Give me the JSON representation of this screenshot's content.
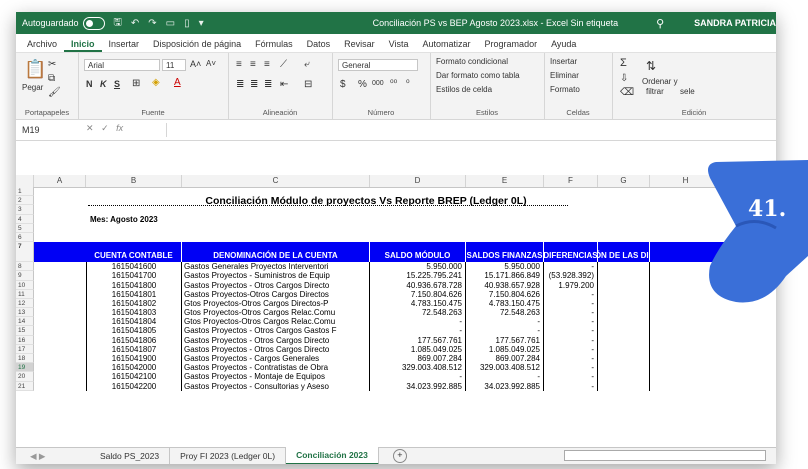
{
  "titlebar": {
    "autosave": "Autoguardado",
    "doc_title": "Conciliación PS vs BEP Agosto 2023.xlsx  -  Excel   Sin etiqueta",
    "user": "SANDRA PATRICIA"
  },
  "ribbon_tabs": [
    "Archivo",
    "Inicio",
    "Insertar",
    "Disposición de página",
    "Fórmulas",
    "Datos",
    "Revisar",
    "Vista",
    "Automatizar",
    "Programador",
    "Ayuda"
  ],
  "ribbon": {
    "paste": "Pegar",
    "font_name": "Arial",
    "font_size": "11",
    "bold": "N",
    "italic": "K",
    "underline": "S",
    "number_format": "General",
    "currency": "$",
    "percent": "%",
    "thousands": "000",
    "cond_format": "Formato condicional",
    "table_format": "Dar formato como tabla",
    "cell_styles": "Estilos de celda",
    "insert": "Insertar",
    "delete": "Eliminar",
    "format": "Formato",
    "sort": "Ordenar y",
    "filter": "filtrar",
    "select": "sele",
    "groups": {
      "clipboard": "Portapapeles",
      "font": "Fuente",
      "alignment": "Alineación",
      "number": "Número",
      "styles": "Estilos",
      "cells": "Celdas",
      "editing": "Edición"
    }
  },
  "formula_bar": {
    "namebox": "M19",
    "fx": "fx"
  },
  "columns": [
    "A",
    "B",
    "C",
    "D",
    "E",
    "F",
    "G",
    "H"
  ],
  "sheet": {
    "title": "Conciliación Módulo de proyectos Vs Reporte BREP (Ledger 0L)",
    "month": "Mes: Agosto 2023",
    "headers": [
      "CUENTA CONTABLE",
      "DENOMINACIÓN DE LA CUENTA",
      "SALDO MÓDULO",
      "SALDOS FINANZAS",
      "DIFERENCIAS",
      "EXPLICACIÓN DE LAS DIFERENCIAS"
    ],
    "rows": [
      {
        "n": "8",
        "account": "1615041600",
        "name": "Gastos Generales Proyectos Interventori",
        "modulo": "5.950.000",
        "finanzas": "5.950.000",
        "dif": "-"
      },
      {
        "n": "9",
        "account": "1615041700",
        "name": "Gastos Proyectos - Suministros de Equip",
        "modulo": "15.225.795.241",
        "finanzas": "15.171.866.849",
        "dif": "(53.928.392)"
      },
      {
        "n": "10",
        "account": "1615041800",
        "name": "Gastos Proyectos - Otros Cargos Directo",
        "modulo": "40.936.678.728",
        "finanzas": "40.938.657.928",
        "dif": "1.979.200"
      },
      {
        "n": "11",
        "account": "1615041801",
        "name": "Gastos Proyectos-Otros Cargos Directos",
        "modulo": "7.150.804.626",
        "finanzas": "7.150.804.626",
        "dif": "-"
      },
      {
        "n": "12",
        "account": "1615041802",
        "name": "Gtos Proyectos-Otros Cargos Directos-P",
        "modulo": "4.783.150.475",
        "finanzas": "4.783.150.475",
        "dif": "-"
      },
      {
        "n": "13",
        "account": "1615041803",
        "name": "Gtos Proyectos-Otros Cargos Relac.Comu",
        "modulo": "72.548.263",
        "finanzas": "72.548.263",
        "dif": "-"
      },
      {
        "n": "14",
        "account": "1615041804",
        "name": "Gtos Proyectos-Otros Cargos Relac.Comu",
        "modulo": "-",
        "finanzas": "-",
        "dif": "-"
      },
      {
        "n": "15",
        "account": "1615041805",
        "name": "Gastos Proyectos - Otros Cargos Gastos F",
        "modulo": "-",
        "finanzas": "-",
        "dif": "-"
      },
      {
        "n": "16",
        "account": "1615041806",
        "name": "Gastos Proyectos - Otros Cargos Directo",
        "modulo": "177.567.761",
        "finanzas": "177.567.761",
        "dif": "-"
      },
      {
        "n": "17",
        "account": "1615041807",
        "name": "Gastos Proyectos - Otros Cargos Directo",
        "modulo": "1.085.049.025",
        "finanzas": "1.085.049.025",
        "dif": "-"
      },
      {
        "n": "18",
        "account": "1615041900",
        "name": "Gastos Proyectos - Cargos Generales",
        "modulo": "869.007.284",
        "finanzas": "869.007.284",
        "dif": "-"
      },
      {
        "n": "19",
        "account": "1615042000",
        "name": "Gastos Proyectos - Contratistas de Obra",
        "modulo": "329.003.408.512",
        "finanzas": "329.003.408.512",
        "dif": "-"
      },
      {
        "n": "20",
        "account": "1615042100",
        "name": "Gastos Proyectos - Montaje de Equipos",
        "modulo": "-",
        "finanzas": "-",
        "dif": "-"
      },
      {
        "n": "21",
        "account": "1615042200",
        "name": "Gastos Proyectos - Consultorias y Aseso",
        "modulo": "34.023.992.885",
        "finanzas": "34.023.992.885",
        "dif": "-"
      }
    ]
  },
  "sheet_tabs": [
    "Saldo PS_2023",
    "Proy FI 2023 (Ledger 0L)",
    "Conciliación 2023"
  ],
  "badge": "41.",
  "colors": {
    "excel_green": "#217346",
    "header_blue": "#0000f5",
    "hand_blue": "#3a6fd8"
  }
}
